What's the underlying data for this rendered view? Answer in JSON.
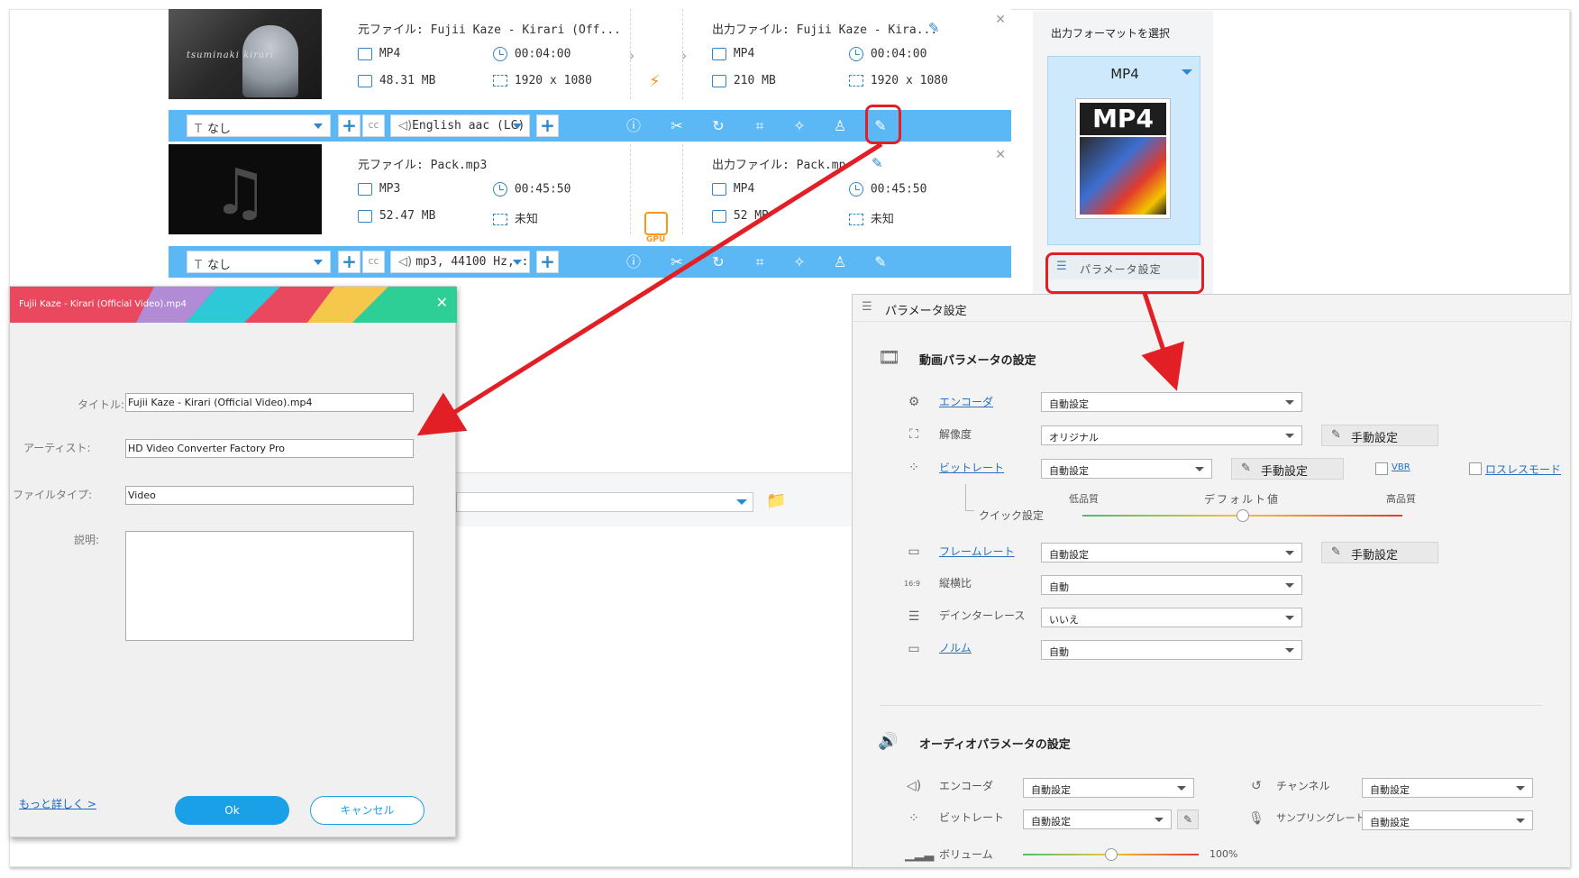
{
  "tasks": [
    {
      "source_label": "元ファイル: Fujii Kaze - Kirari (Off...",
      "source_format": "MP4",
      "source_duration": "00:04:00",
      "source_size": "48.31 MB",
      "source_resolution": "1920 x 1080",
      "output_label": "出力ファイル: Fujii Kaze - Kira...",
      "output_format": "MP4",
      "output_duration": "00:04:00",
      "output_size": "210 MB",
      "output_resolution": "1920 x 1080",
      "thumb_caption": "tsuminaki kirari"
    },
    {
      "source_label": "元ファイル: Pack.mp3",
      "source_format": "MP3",
      "source_duration": "00:45:50",
      "source_size": "52.47 MB",
      "source_resolution": "未知",
      "output_label": "出力ファイル: Pack.mp",
      "output_format": "MP4",
      "output_duration": "00:45:50",
      "output_size": "52 MB",
      "output_resolution": "未知",
      "gpu_label": "GPU"
    }
  ],
  "toolbars": [
    {
      "subtitle": "なし",
      "audio": "English aac (LC)"
    },
    {
      "subtitle": "なし",
      "audio": "mp3, 44100 Hz, :"
    }
  ],
  "format_panel": {
    "title": "出力フォーマットを選択",
    "selected_format": "MP4",
    "format_image_text": "MP4",
    "param_button": "パラメータ設定"
  },
  "metadata_dialog": {
    "title": "Fujii Kaze - Kirari (Official Video).mp4",
    "title_label": "タイトル:",
    "title_value": "Fujii Kaze - Kirari (Official Video).mp4",
    "artist_label": "アーティスト:",
    "artist_value": "HD Video Converter Factory Pro",
    "filetype_label": "ファイルタイプ:",
    "filetype_value": "Video",
    "description_label": "説明:",
    "more_link": "もっと詳しく >",
    "ok_label": "Ok",
    "cancel_label": "キャンセル"
  },
  "param_window": {
    "title": "パラメータ設定",
    "video_section": "動画パラメータの設定",
    "encoder_label": "エンコーダ",
    "encoder_value": "自動設定",
    "resolution_label": "解像度",
    "resolution_value": "オリジナル",
    "manual_label": "手動設定",
    "bitrate_label": "ビットレート",
    "bitrate_value": "自動設定",
    "vbr_label": "VBR",
    "lossless_label": "ロスレスモード",
    "quick_label": "クイック設定",
    "low_quality": "低品質",
    "default_value": "デフォルト値",
    "high_quality": "高品質",
    "quality_level": 0.5,
    "framerate_label": "フレームレート",
    "framerate_value": "自動設定",
    "aspect_label": "縦横比",
    "aspect_value": "自動",
    "aspect_icon_text": "16:9",
    "deinterlace_label": "デインターレース",
    "deinterlace_value": "いいえ",
    "norm_label": "ノルム",
    "norm_value": "自動",
    "audio_section": "オーディオパラメータの設定",
    "a_encoder_label": "エンコーダ",
    "a_encoder_value": "自動設定",
    "channel_label": "チャンネル",
    "channel_value": "自動設定",
    "a_bitrate_label": "ビットレート",
    "a_bitrate_value": "自動設定",
    "samplerate_label": "サンプリングレート",
    "samplerate_value": "自動設定",
    "volume_label": "ボリューム",
    "volume_value": "100%",
    "volume_level": 0.5
  },
  "colors": {
    "toolbar_blue": "#5cb8f5",
    "accent_blue": "#2f86c8",
    "arrow_red": "#e31f26",
    "ok_button": "#1aa0e6"
  }
}
